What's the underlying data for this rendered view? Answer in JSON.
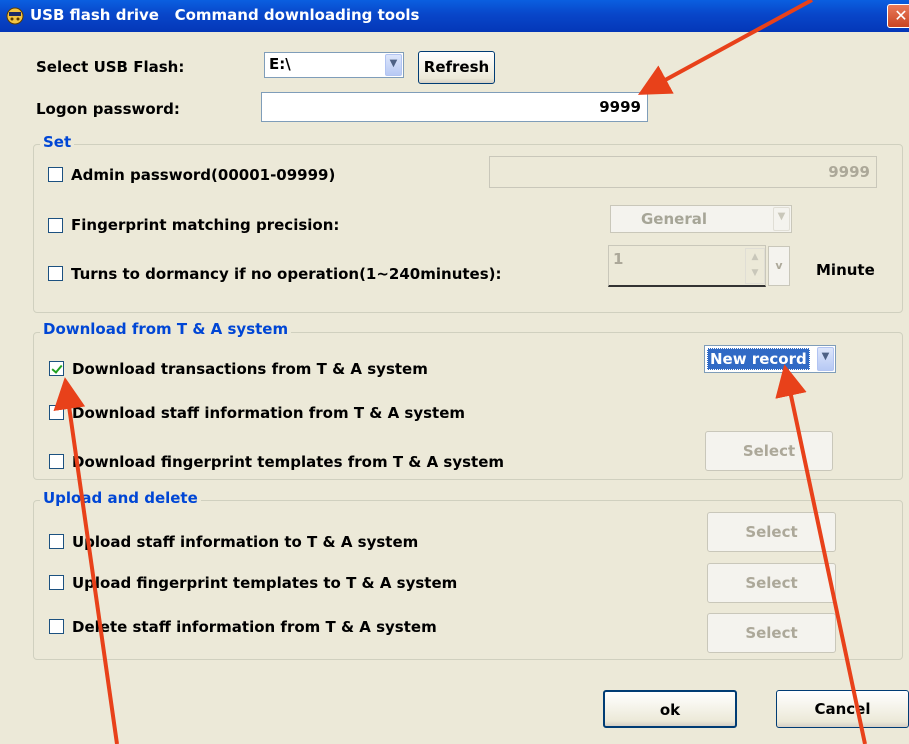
{
  "window": {
    "title": "USB flash drive   Command downloading tools",
    "close_glyph": "✕"
  },
  "usb": {
    "label": "Select USB Flash:",
    "drive": "E:\\",
    "refresh": "Refresh"
  },
  "logon": {
    "label": "Logon password:",
    "value": "9999"
  },
  "set": {
    "title": "Set",
    "admin_label": "Admin password(00001-09999)",
    "admin_value": "9999",
    "precision_label": "Fingerprint matching precision:",
    "precision_value": "General",
    "dormancy_label": "Turns to dormancy if no operation(1~240minutes):",
    "dormancy_value": "1",
    "dormancy_unit": "Minute"
  },
  "download": {
    "title": "Download from T & A system",
    "transactions_label": "Download transactions from T & A system",
    "transactions_checked": true,
    "record_value": "New record",
    "staff_label": "Download staff information from T & A system",
    "templates_label": "Download fingerprint templates from T & A system",
    "select_label": "Select"
  },
  "upload": {
    "title": "Upload and delete",
    "staff_label": "Upload staff information to T & A system",
    "templates_label": "Upload fingerprint templates to T & A system",
    "delete_label": "Delete staff information from T & A system",
    "select_label": "Select"
  },
  "footer": {
    "ok": "ok",
    "cancel": "Cancel"
  },
  "colors": {
    "annotation_arrow": "#e8411a",
    "group_title": "#0046d5",
    "titlebar": "#0a5fe0"
  }
}
